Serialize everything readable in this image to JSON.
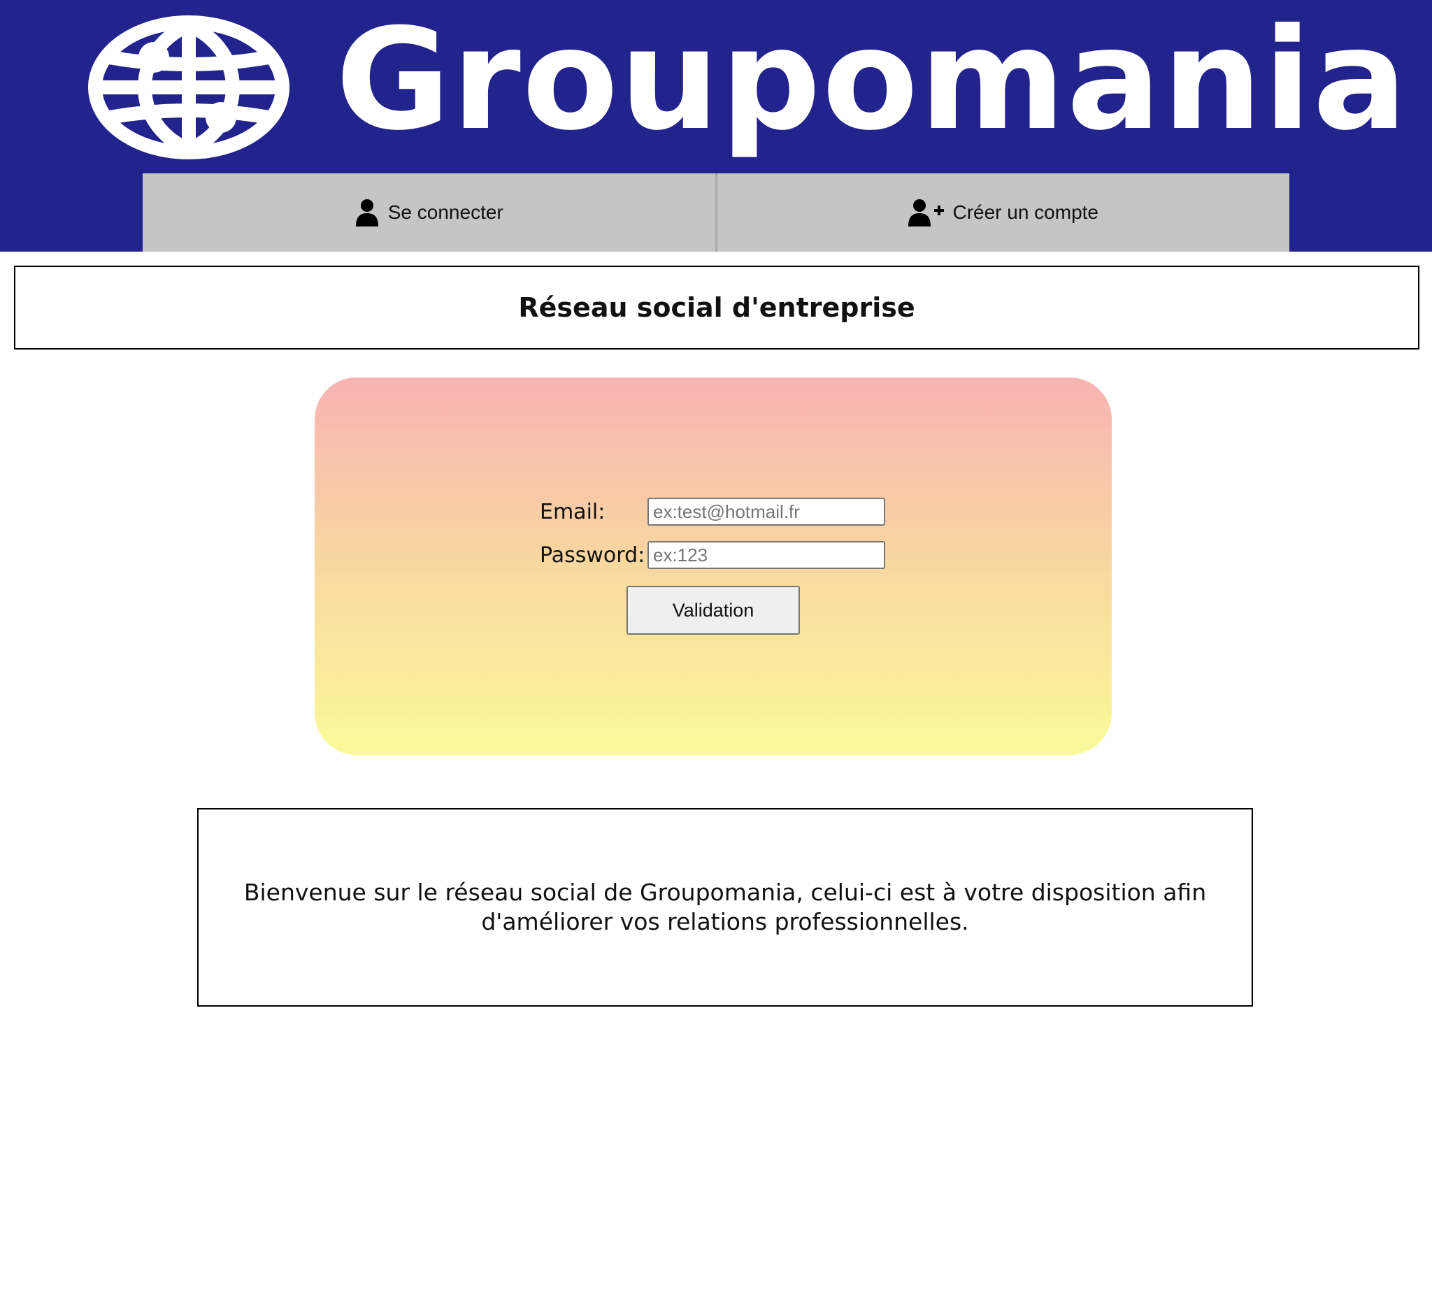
{
  "header": {
    "brand_name": "Groupomania",
    "logo_icon": "globe-icon",
    "nav": {
      "login_label": "Se connecter",
      "login_icon": "user-icon",
      "signup_label": "Créer un compte",
      "signup_icon": "user-plus-icon"
    }
  },
  "page": {
    "title": "Réseau social d'entreprise"
  },
  "login_form": {
    "email_label": "Email:",
    "email_placeholder": "ex:test@hotmail.fr",
    "email_value": "",
    "password_label": "Password:",
    "password_placeholder": "ex:123",
    "password_value": "",
    "submit_label": "Validation"
  },
  "welcome": {
    "text": "Bienvenue sur le réseau social de Groupomania, celui-ci est à votre disposition afin d'améliorer vos relations professionnelles."
  },
  "colors": {
    "header_bg": "#22238c",
    "nav_bg": "#c5c5c5",
    "card_gradient_top": "#f7b3b3",
    "card_gradient_bottom": "#fafa9a"
  }
}
